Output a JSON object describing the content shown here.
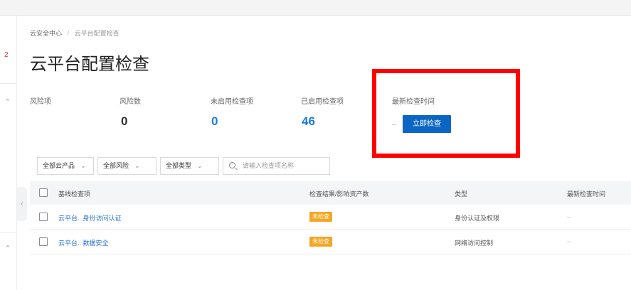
{
  "left_rail": {
    "badge": "2"
  },
  "breadcrumb": {
    "root": "云安全中心",
    "separator": "/",
    "current": "云平台配置检查"
  },
  "page_title": "云平台配置检查",
  "stats": [
    {
      "label": "风险项",
      "value": ""
    },
    {
      "label": "风险数",
      "value": "0"
    },
    {
      "label": "未启用检查项",
      "value": "0"
    },
    {
      "label": "已启用检查项",
      "value": "46"
    }
  ],
  "last_check": {
    "label": "最新检查时间",
    "value": "--",
    "button": "立即检查"
  },
  "filters": {
    "product": "全部云产品",
    "risk": "全部风险",
    "type": "全部类型",
    "search_placeholder": "请输入检查项名称"
  },
  "table": {
    "headers": [
      "基线检查项",
      "检查结果/影响资产数",
      "类型",
      "最新检查时间"
    ],
    "rows": [
      {
        "name": "云平台...身份访问认证",
        "status": "未检查",
        "type": "身份认证及权限",
        "time": "--"
      },
      {
        "name": "云平台...数据安全",
        "status": "未检查",
        "type": "网络访问控制",
        "time": "--"
      }
    ]
  },
  "colors": {
    "primary": "#0a66c2",
    "value_blue": "#1f7ad6",
    "warning_tag": "#f5a623",
    "highlight": "#ff0000"
  }
}
